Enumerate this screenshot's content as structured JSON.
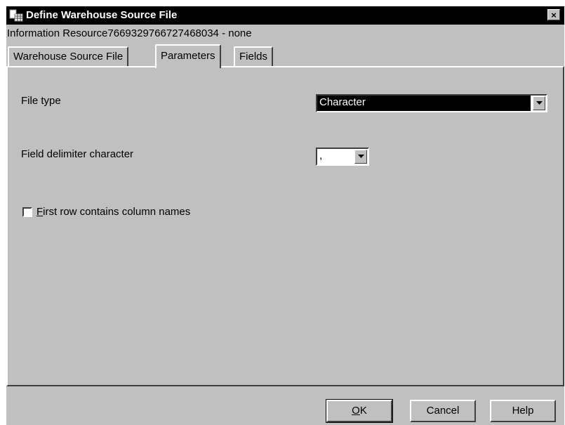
{
  "window": {
    "title": "Define Warehouse Source File",
    "close_label": "×"
  },
  "info_line": "Information Resource7669329766727468034 - none",
  "tabs": [
    {
      "label": "Warehouse Source File",
      "active": false
    },
    {
      "label": "Parameters",
      "active": true
    },
    {
      "label": "Fields",
      "active": false
    }
  ],
  "form": {
    "file_type_label": "File type",
    "file_type_value": "Character",
    "field_delimiter_label": "Field delimiter character",
    "field_delimiter_value": ",",
    "first_row_checkbox": {
      "label_first_char": "F",
      "label_rest": "irst row contains column names",
      "checked": false
    }
  },
  "buttons": {
    "ok_first": "O",
    "ok_rest": "K",
    "cancel": "Cancel",
    "help": "Help"
  },
  "icons": {
    "title_icon": "file-table-icon",
    "dropdown_arrow": "chevron-down-icon"
  }
}
